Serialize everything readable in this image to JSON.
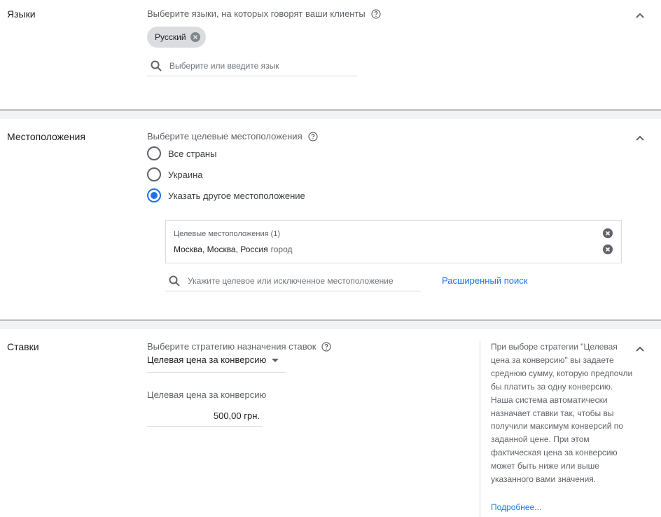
{
  "languages": {
    "title": "Языки",
    "subtitle": "Выберите языки, на которых говорят ваши клиенты",
    "chip_label": "Русский",
    "search_placeholder": "Выберите или введите язык"
  },
  "locations": {
    "title": "Местоположения",
    "subtitle": "Выберите целевые местоположения",
    "options": [
      {
        "label": "Все страны",
        "selected": false
      },
      {
        "label": "Украина",
        "selected": false
      },
      {
        "label": "Указать другое местоположение",
        "selected": true
      }
    ],
    "targets_header": "Целевые местоположения (1)",
    "target_name": "Москва, Москва, Россия",
    "target_type": "город",
    "search_placeholder": "Укажите целевое или исключенное местоположение",
    "advanced_search": "Расширенный поиск"
  },
  "bids": {
    "title": "Ставки",
    "subtitle": "Выберите стратегию назначения ставок",
    "strategy": "Целевая цена за конверсию",
    "field_label": "Целевая цена за конверсию",
    "amount": "500,00 грн.",
    "help_text": "При выборе стратегии \"Целевая цена за конверсию\" вы задаете среднюю сумму, которую предпочли бы платить за одну конверсию. Наша система автоматически назначает ставки так, чтобы вы получили максимум конверсий по заданной цене. При этом фактическая цена за конверсию может быть ниже или выше указанного вами значения.",
    "learn_more": "Подробнее..."
  },
  "icons": {
    "help": "help-circle-icon",
    "collapse": "chevron-up-icon",
    "search": "search-icon",
    "remove": "close-circle-icon"
  },
  "colors": {
    "accent": "#1a73e8",
    "divider": "#f1f3f4"
  }
}
